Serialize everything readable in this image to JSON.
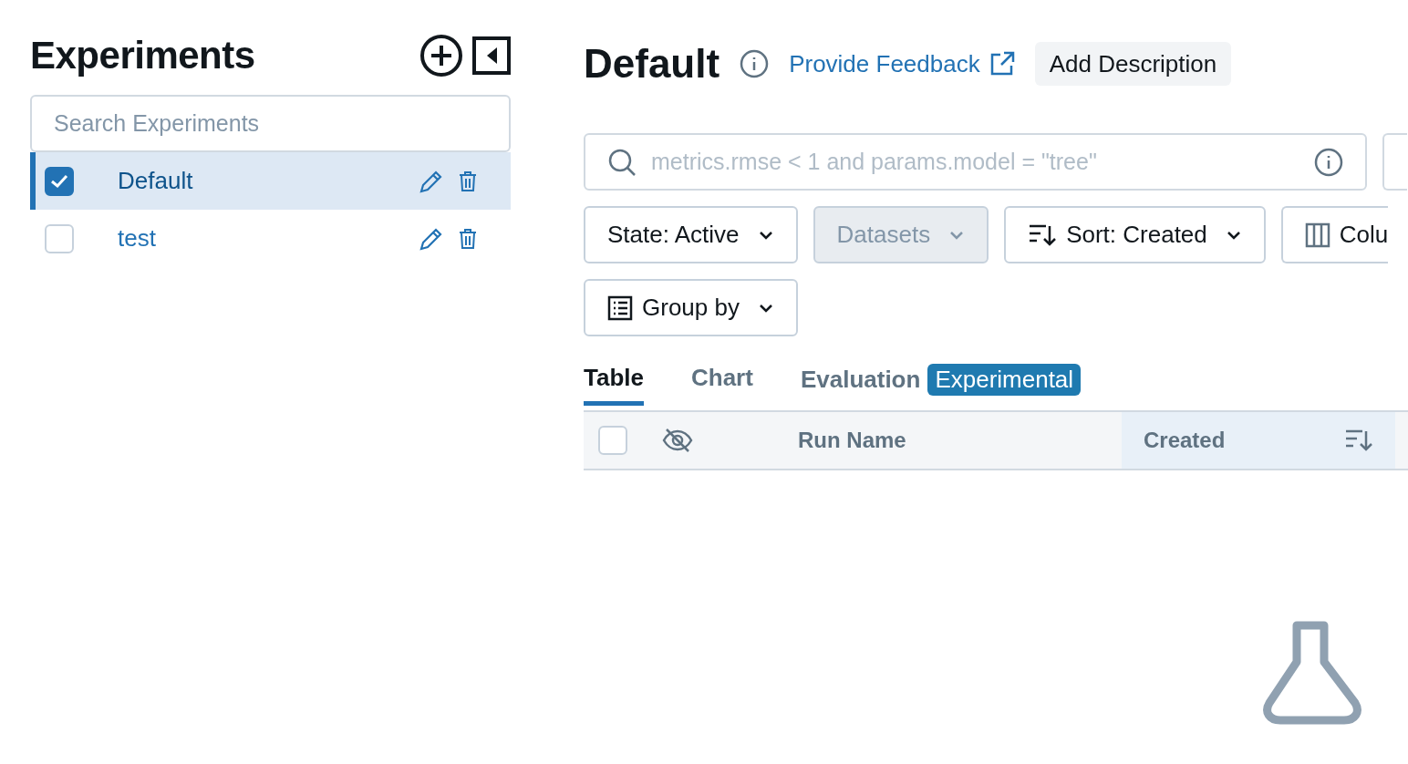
{
  "sidebar": {
    "title": "Experiments",
    "search": {
      "placeholder": "Search Experiments"
    },
    "experiments": [
      {
        "name": "Default",
        "checked": true,
        "selected": true
      },
      {
        "name": "test",
        "checked": false,
        "selected": false
      }
    ]
  },
  "header": {
    "title": "Default",
    "feedback_link": "Provide Feedback",
    "description_button": "Add Description"
  },
  "search": {
    "placeholder": "metrics.rmse < 1 and params.model = \"tree\""
  },
  "filters": [
    {
      "kind": "dropdown",
      "label": "State: Active",
      "disabled": false
    },
    {
      "kind": "dropdown",
      "label": "Datasets",
      "disabled": true
    },
    {
      "kind": "sort",
      "label": "Sort: Created",
      "disabled": false
    },
    {
      "kind": "columns",
      "label": "Colu",
      "disabled": false
    },
    {
      "kind": "group",
      "label": "Group by",
      "disabled": false
    }
  ],
  "tabs": [
    {
      "label": "Table",
      "selected": true
    },
    {
      "label": "Chart",
      "selected": false
    },
    {
      "label": "Evaluation",
      "selected": false,
      "badge": "Experimental"
    }
  ],
  "table": {
    "columns": [
      {
        "kind": "checkbox",
        "checked": false
      },
      {
        "kind": "visibility"
      },
      {
        "kind": "text",
        "label": "Run Name",
        "sorted": false
      },
      {
        "kind": "text",
        "label": "Created",
        "sorted": true
      }
    ]
  }
}
